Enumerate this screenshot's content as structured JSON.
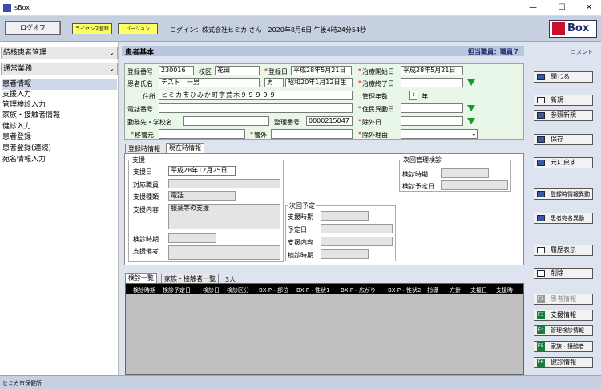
{
  "window": {
    "title": "sBox",
    "min_glyph": "—",
    "max_glyph": "☐",
    "close_glyph": "✕"
  },
  "topbar": {
    "logoff_label": "ログオフ",
    "license_label": "ライセンス登録",
    "version_label": "バージョン",
    "login_info": "ログイン：株式会社ヒミカ さん　2020年8月6日 午後4時24分54秒",
    "logo_text": "Box"
  },
  "sidebar": {
    "combo1": "結核患者管理",
    "combo2": "通常業務",
    "items": [
      "患者情報",
      "支援入力",
      "管理検診入力",
      "家族・接触者情報",
      "健診入力",
      "患者登録",
      "患者登録(連続)",
      "宛名情報入力"
    ]
  },
  "header": {
    "title": "患者基本",
    "staff": "担当職員：職員７",
    "comment_link": "コメント"
  },
  "patient": {
    "reg_no_label": "登録番号",
    "reg_no": "230016",
    "district_label": "校区",
    "district": "花田",
    "reg_date_label": "登録日",
    "reg_date": "平成28年5月21日",
    "treat_start_label": "治療開始日",
    "treat_start": "平成28年5月21日",
    "name_label": "患者氏名",
    "name": "テスト　一男",
    "sex": "男",
    "birth": "昭和20年1月12日生",
    "treat_end_label": "治療終了日",
    "treat_end": "",
    "address_label": "住所",
    "address": "ヒミカ市ひみか町字荒木９９９９９",
    "mgmt_years_label": "管理年数",
    "mgmt_years_unit": "年",
    "phone_label": "電話番号",
    "phone": "",
    "resident_change_label": "住民異動日",
    "resident_change": "",
    "workplace_label": "勤務先・学校名",
    "workplace": "",
    "ref_no_label": "整理番号",
    "ref_no": "0000215047",
    "exclusion_date_label": "除外日",
    "exclusion_date": "",
    "transfer_label": "移管元",
    "transfer": "",
    "outside_label": "管外",
    "outside": "",
    "exclusion_reason_label": "除外理由",
    "exclusion_reason": ""
  },
  "tabs_top": [
    "登録時情報",
    "現在時情報"
  ],
  "support": {
    "group_title": "支援",
    "date_label": "支援日",
    "date": "平成28年12月25日",
    "staff_label": "対応職員",
    "staff": "",
    "type_label": "支援種類",
    "type": "電話",
    "content_label": "支援内容",
    "content": "服薬等の支援",
    "exam_time_label": "検診時期",
    "exam_time": "",
    "remarks_label": "支援備考",
    "remarks": ""
  },
  "next_mgmt": {
    "group_title": "次回管理検診",
    "exam_time_label": "検診時期",
    "exam_time": "",
    "exam_plan_label": "検診予定日",
    "exam_plan": ""
  },
  "next_plan": {
    "group_title": "次回予定",
    "time_label": "支援時期",
    "time": "",
    "date_label": "予定日",
    "date": "",
    "content_label": "支援内容",
    "content": "",
    "exam_label": "検診時期",
    "exam": ""
  },
  "tabs_bottom": [
    "検診一覧",
    "家族・接触者一覧",
    "3人"
  ],
  "table_headers": [
    "検診時期",
    "検診予定日",
    "検診日",
    "検診区分",
    "BX-P・部位",
    "BX-P・性状1",
    "BX-P・広がり",
    "BX-P・性状2",
    "指導",
    "方針",
    "支援日",
    "支援時"
  ],
  "right_buttons": [
    {
      "label": "閉じる"
    },
    {
      "label": "新規"
    },
    {
      "label": "参照新規"
    },
    {
      "label": "保存"
    },
    {
      "label": "元に戻す"
    },
    {
      "label": "登録時情報異動"
    },
    {
      "label": "患者宛名異動"
    },
    {
      "label": "履歴表示"
    },
    {
      "label": "削除"
    }
  ],
  "fkeys": [
    {
      "key": "F2",
      "label": "患者情報"
    },
    {
      "key": "F3",
      "label": "支援情報"
    },
    {
      "key": "F4",
      "label": "管理検診情報"
    },
    {
      "key": "F5",
      "label": "家族・接触者"
    },
    {
      "key": "F6",
      "label": "健診情報"
    }
  ],
  "status": {
    "text": "ヒミカ市保健所"
  },
  "colors": {
    "accent": "#1a9a2a",
    "header_bg": "#b8c6de",
    "required": "#dd0000"
  }
}
